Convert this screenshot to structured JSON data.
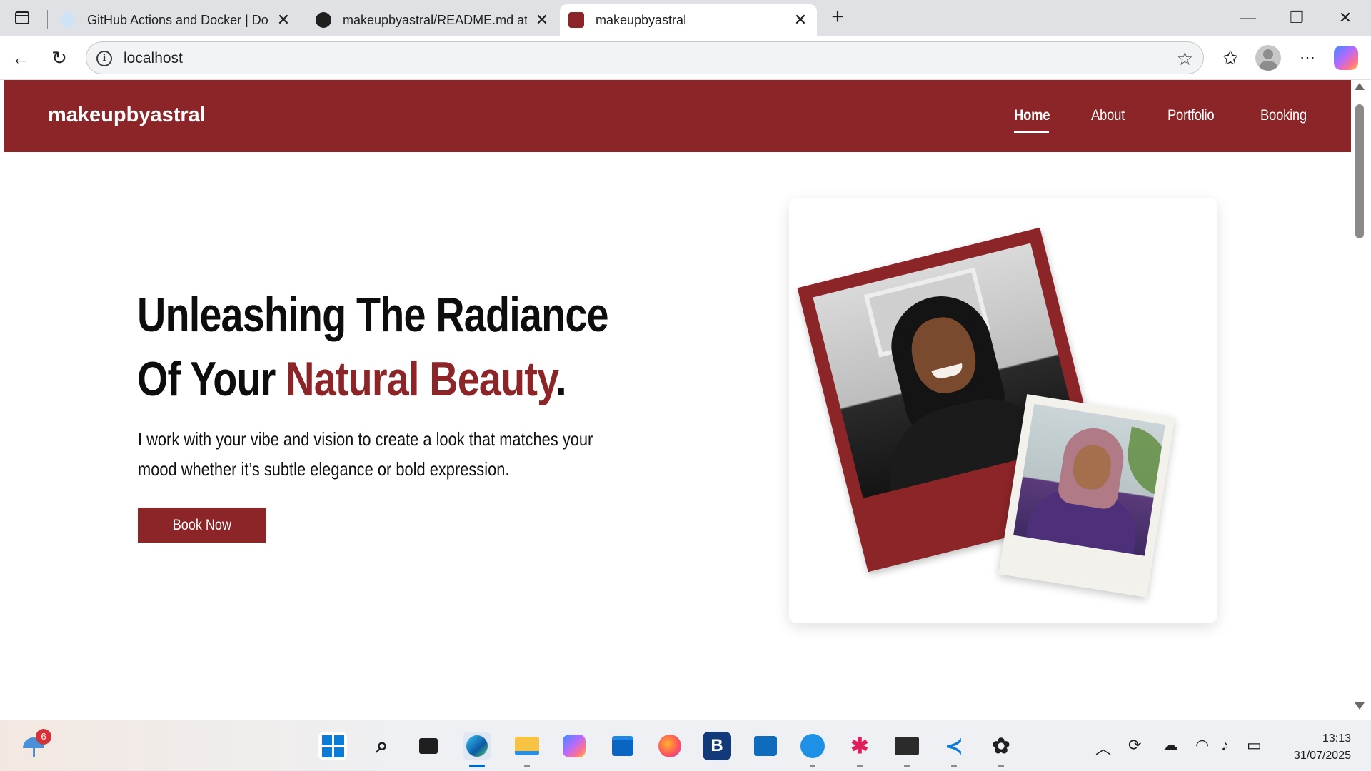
{
  "browser": {
    "tabs": [
      {
        "title": "GitHub Actions and Docker | Dock",
        "favicon": "docker-favicon"
      },
      {
        "title": "makeupbyastral/README.md at m",
        "favicon": "github-favicon"
      },
      {
        "title": "makeupbyastral",
        "favicon": "site-favicon",
        "active": true
      }
    ],
    "address": "localhost"
  },
  "site": {
    "logo": "makeupbyastral",
    "nav": [
      {
        "label": "Home",
        "active": true
      },
      {
        "label": "About"
      },
      {
        "label": "Portfolio"
      },
      {
        "label": "Booking"
      }
    ],
    "hero": {
      "title_line1": "Unleashing The Radiance",
      "title_line2_prefix": "Of Your ",
      "title_accent": "Natural Beauty",
      "title_suffix": ".",
      "subtitle": "I work with your vibe and vision to create a look that matches your mood whether it’s subtle elegance or bold expression.",
      "cta": "Book Now"
    },
    "colors": {
      "brand": "#8b2528",
      "text": "#0d0d0d",
      "polaroid_white": "#f3f1ec"
    }
  },
  "taskbar": {
    "weather_badge": "6",
    "apps": [
      "start-icon",
      "search-icon",
      "task-view-icon",
      "edge-icon",
      "file-explorer-icon",
      "copilot-icon",
      "store-icon",
      "firefox-icon",
      "b-app-icon",
      "outlook-icon",
      "docker-icon",
      "slack-icon",
      "terminal-icon",
      "vscode-icon",
      "chatgpt-icon"
    ],
    "time": "13:13",
    "date": "31/07/2025"
  }
}
